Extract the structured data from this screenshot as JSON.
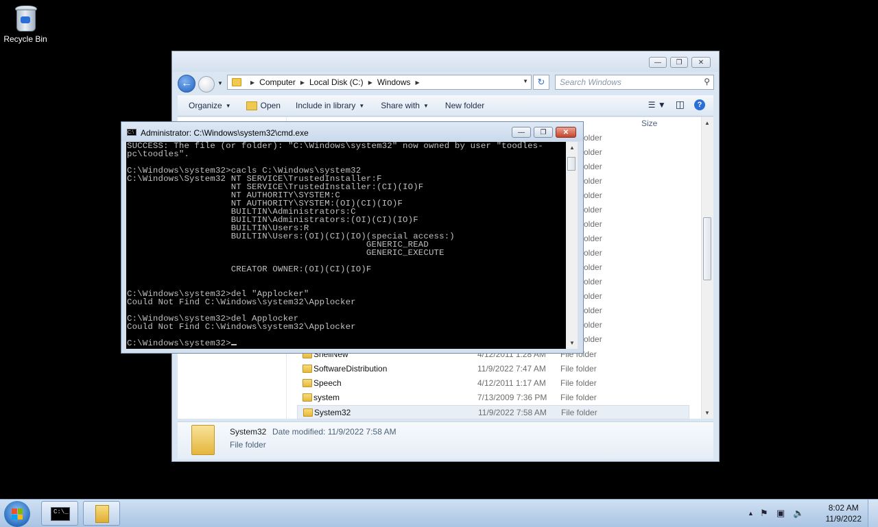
{
  "desktop": {
    "recycle_bin_label": "Recycle Bin"
  },
  "explorer": {
    "breadcrumb": [
      "Computer",
      "Local Disk (C:)",
      "Windows"
    ],
    "search_placeholder": "Search Windows",
    "toolbar": {
      "organize": "Organize",
      "open": "Open",
      "include_in_library": "Include in library",
      "share_with": "Share with",
      "new_folder": "New folder"
    },
    "column_header_size": "Size",
    "files": [
      {
        "name": "ShellNew",
        "date": "4/12/2011 1:28 AM",
        "type": "File folder"
      },
      {
        "name": "SoftwareDistribution",
        "date": "11/9/2022 7:47 AM",
        "type": "File folder"
      },
      {
        "name": "Speech",
        "date": "4/12/2011 1:17 AM",
        "type": "File folder"
      },
      {
        "name": "system",
        "date": "7/13/2009 7:36 PM",
        "type": "File folder"
      },
      {
        "name": "System32",
        "date": "11/9/2022 7:58 AM",
        "type": "File folder"
      }
    ],
    "hidden_type_fragments": [
      "older",
      "older",
      "older",
      "older",
      "older",
      "older",
      "older",
      "older",
      "older",
      "older",
      "older",
      "older",
      "older",
      "older",
      "older"
    ],
    "details": {
      "name": "System32",
      "date_modified": "Date modified: 11/9/2022 7:58 AM",
      "type": "File folder"
    }
  },
  "cmd": {
    "title": "Administrator: C:\\Windows\\system32\\cmd.exe",
    "output": "SUCCESS: The file (or folder): \"C:\\Windows\\system32\" now owned by user \"toodles-\npc\\toodles\".\n\nC:\\Windows\\system32>cacls C:\\Windows\\system32\nC:\\Windows\\System32 NT SERVICE\\TrustedInstaller:F\n                    NT SERVICE\\TrustedInstaller:(CI)(IO)F\n                    NT AUTHORITY\\SYSTEM:C\n                    NT AUTHORITY\\SYSTEM:(OI)(CI)(IO)F\n                    BUILTIN\\Administrators:C\n                    BUILTIN\\Administrators:(OI)(CI)(IO)F\n                    BUILTIN\\Users:R\n                    BUILTIN\\Users:(OI)(CI)(IO)(special access:)\n                                              GENERIC_READ\n                                              GENERIC_EXECUTE\n\n                    CREATOR OWNER:(OI)(CI)(IO)F\n\n\nC:\\Windows\\system32>del \"Applocker\"\nCould Not Find C:\\Windows\\system32\\Applocker\n\nC:\\Windows\\system32>del Applocker\nCould Not Find C:\\Windows\\system32\\Applocker\n\nC:\\Windows\\system32>"
  },
  "taskbar": {
    "time": "8:02 AM",
    "date": "11/9/2022"
  }
}
